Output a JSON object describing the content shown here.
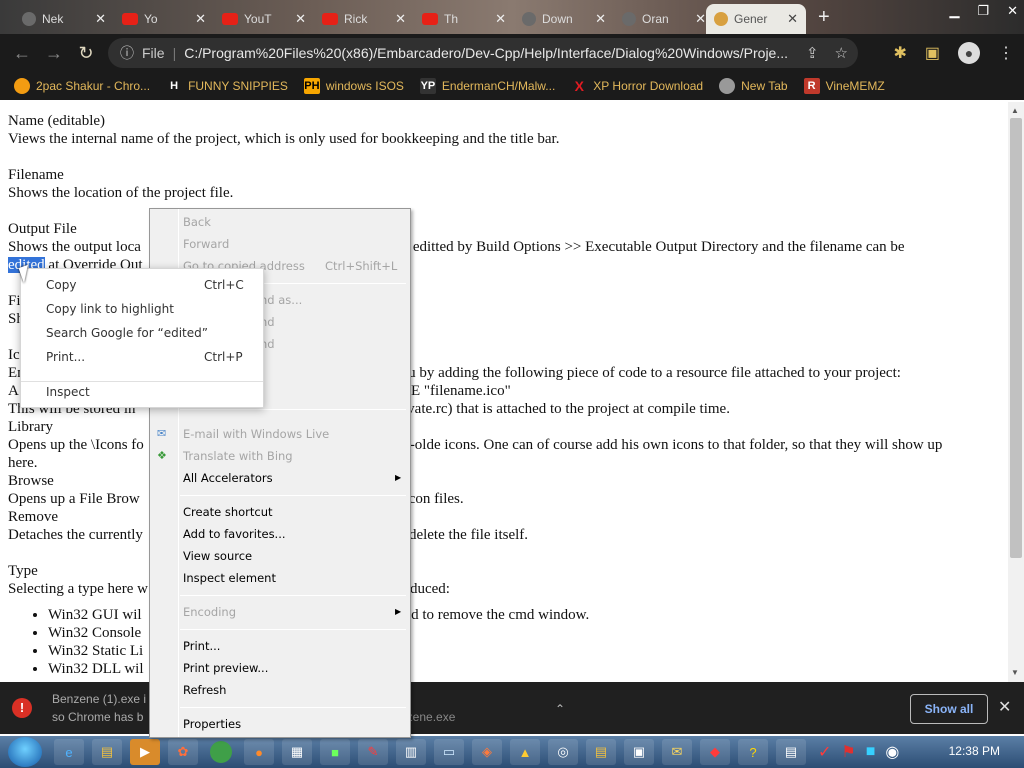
{
  "tabs": [
    {
      "title": "Nek",
      "fav": "g"
    },
    {
      "title": "Yo",
      "fav": "y"
    },
    {
      "title": "YouT",
      "fav": "y"
    },
    {
      "title": "Rick",
      "fav": "y"
    },
    {
      "title": "Th",
      "fav": "y"
    },
    {
      "title": "Down",
      "fav": "g"
    },
    {
      "title": "Oran",
      "fav": "g"
    },
    {
      "title": "Gener",
      "fav": "c"
    }
  ],
  "toolbar": {
    "back_icon": "arrow-left-icon",
    "forward_icon": "arrow-right-icon",
    "reload_icon": "reload-icon",
    "site_label": "File",
    "url": "C:/Program%20Files%20(x86)/Embarcadero/Dev-Cpp/Help/Interface/Dialog%20Windows/Proje..."
  },
  "bookmarks": [
    {
      "label": "2pac Shakur - Chro...",
      "badge": "",
      "color": "#f39c12"
    },
    {
      "label": "FUNNY SNIPPIES",
      "badge": "H",
      "color": "#ffffff"
    },
    {
      "label": "windows ISOS",
      "badge": "PH",
      "color": "#f7a600"
    },
    {
      "label": "EndermanCH/Malw...",
      "badge": "YP",
      "color": "#333333"
    },
    {
      "label": "XP Horror Download",
      "badge": "X",
      "color": "#e01b22"
    },
    {
      "label": "New Tab",
      "badge": "",
      "color": "#999999"
    },
    {
      "label": "VineMEMZ",
      "badge": "R",
      "color": "#c0392b"
    }
  ],
  "content": {
    "line1": "Name (editable)",
    "line2": "Views the internal name of the project, which is only used for bookkeeping and the title bar.",
    "line3": "Filename",
    "line4": "Shows the location of the project file.",
    "line5": "Output File",
    "line6a": "Shows the output loca",
    "line6b": "be editted by Build Options >> Executable Output Directory and the filename can be",
    "line7_hl": "edited",
    "line7b": " at Override Out",
    "line8": "Fi",
    "line9": "Sh",
    "line10": "Ic",
    "line11a": "En",
    "line11b": "ou by adding the following piece of code to a resource file attached to your project:",
    "line12a": "A",
    "line12b": "LE \"filename.ico\"",
    "line13a": "This will be stored in",
    "line13b": "private.rc) that is attached to the project at compile time.",
    "line14": "Library",
    "line15a": "Opens up the \\Icons fo",
    "line15b": "-olde icons. One can of course add his own icons to that folder, so that they will show up",
    "line16": "here.",
    "line17": "Browse",
    "line18a": "Opens up a File Brow",
    "line18b": "con files.",
    "line19": "Remove",
    "line20a": "Detaches the currently",
    "line20b": "delete the file itself.",
    "line21": "Type",
    "line22a": "Selecting a type here w",
    "line22b": "duced:",
    "bullets": [
      "Win32 GUI wil",
      "Win32 Console",
      "Win32 Static Li",
      "Win32 DLL wil"
    ],
    "bullet1b": "nd to remove the cmd window."
  },
  "download": {
    "line1": "Benzene (1).exe i",
    "line2": "so Chrome has b",
    "file2": "nzene.exe",
    "show_all": "Show all"
  },
  "ie_menu": {
    "back": "Back",
    "forward": "Forward",
    "go_copied": "Go to copied address",
    "go_copied_sc": "Ctrl+Shift+L",
    "save_as": "nd as...",
    "find1": "nd",
    "find2": "nd",
    "email": "E-mail with Windows Live",
    "translate": "Translate with Bing",
    "accelerators": "All Accelerators",
    "create_shortcut": "Create shortcut",
    "favorites": "Add to favorites...",
    "view_source": "View source",
    "inspect_element": "Inspect element",
    "encoding": "Encoding",
    "print": "Print...",
    "print_preview": "Print preview...",
    "refresh": "Refresh",
    "properties": "Properties"
  },
  "chrome_menu": {
    "copy": "Copy",
    "copy_sc": "Ctrl+C",
    "copy_link": "Copy link to highlight",
    "search": "Search Google for “edited”",
    "print": "Print...",
    "print_sc": "Ctrl+P",
    "inspect": "Inspect"
  },
  "taskbar": {
    "clock": "12:38 PM"
  }
}
